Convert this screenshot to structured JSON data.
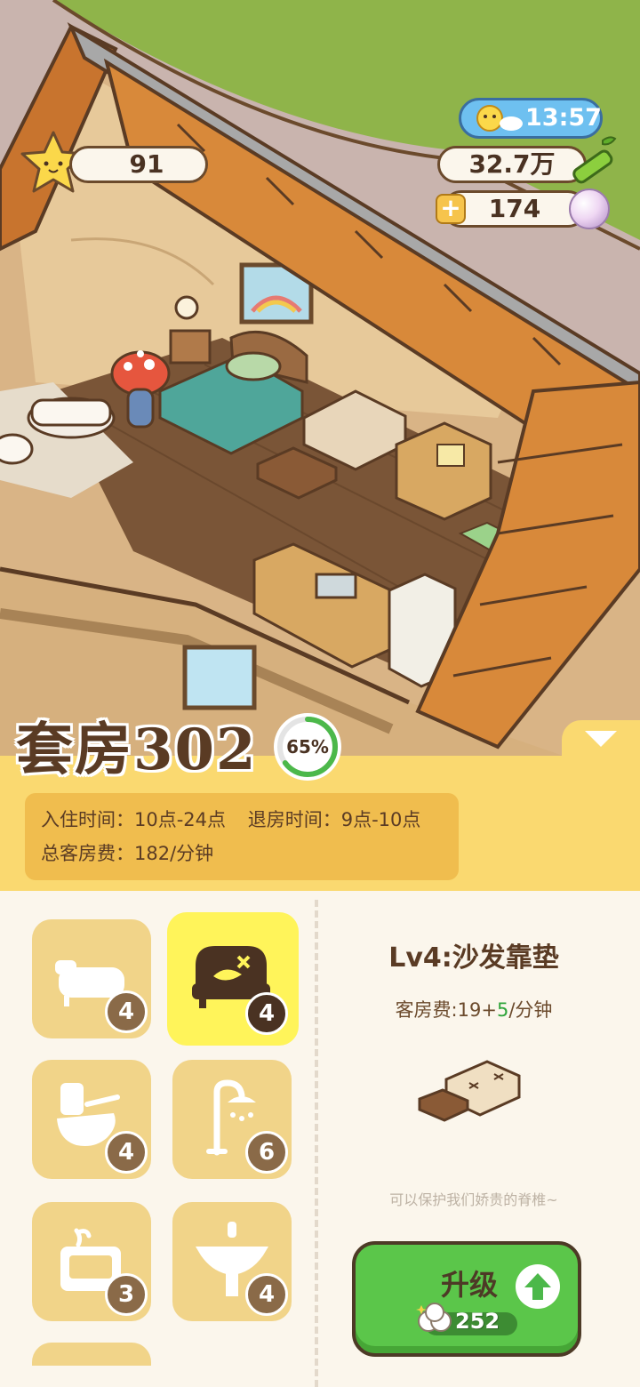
{
  "hud": {
    "stars": "91",
    "time": "13:57",
    "bamboo": "32.7万",
    "pearls": "174",
    "add_label": "+"
  },
  "room": {
    "title": "套房302",
    "progress": 0.65,
    "progress_label": "65%",
    "checkin_label": "入住时间：10点-24点",
    "checkout_label": "退房时间：9点-10点",
    "total_fee_label": "总客房费：182/分钟"
  },
  "items": [
    {
      "icon": "bathtub-icon",
      "level": "4"
    },
    {
      "icon": "sofa-icon",
      "level": "4",
      "selected": true
    },
    {
      "icon": "toilet-icon",
      "level": "4"
    },
    {
      "icon": "shower-icon",
      "level": "6"
    },
    {
      "icon": "cabinet-icon",
      "level": "3"
    },
    {
      "icon": "sink-icon",
      "level": "4"
    }
  ],
  "detail": {
    "title": "Lv4:沙发靠垫",
    "fee_prefix": "客房费:19+",
    "fee_plus": "5",
    "fee_suffix": "/分钟",
    "description": "可以保护我们娇贵的脊椎~"
  },
  "upgrade": {
    "label": "升级",
    "cost": "252"
  },
  "colors": {
    "panel_yellow": "#fad970",
    "info_box": "#f0bd4e",
    "selected_item": "#fff45a",
    "item_bg": "#f1d489",
    "upgrade_green": "#5bc64a",
    "text_brown": "#5a3b24"
  }
}
